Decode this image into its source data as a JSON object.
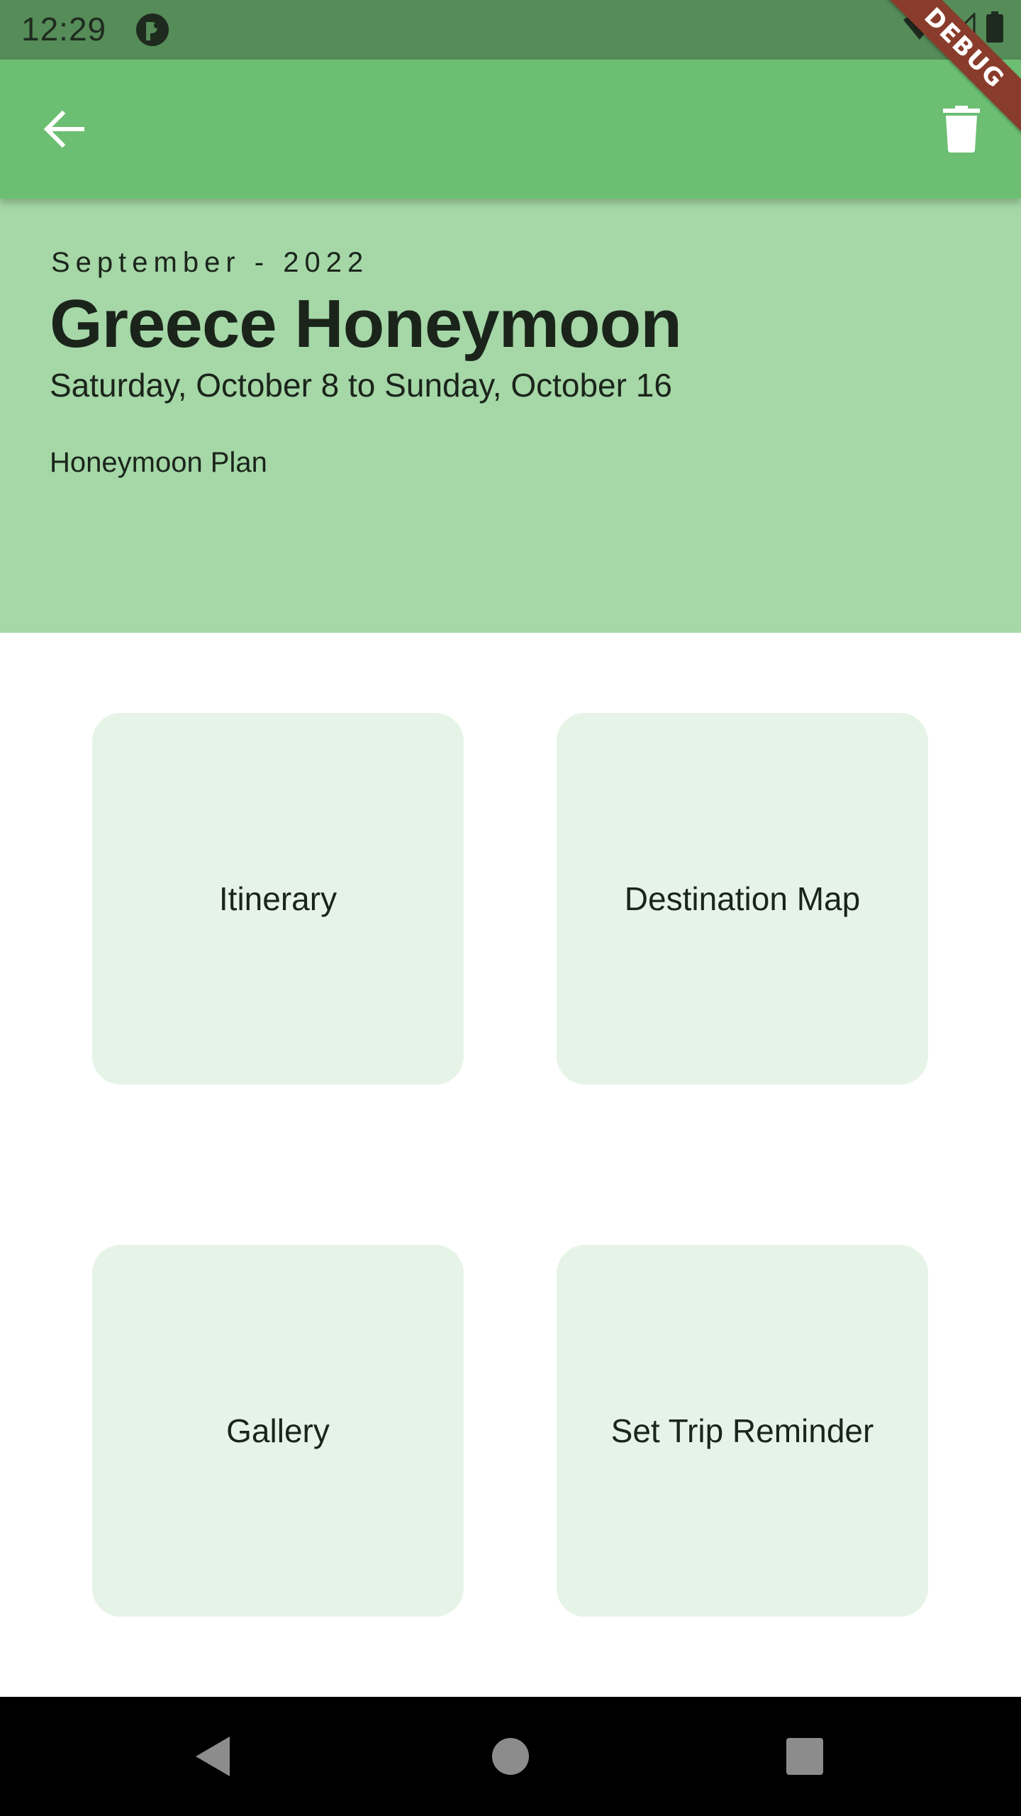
{
  "status_bar": {
    "time": "12:29",
    "icons": [
      "app-notification-icon",
      "wifi-icon",
      "signal-icon",
      "battery-icon"
    ]
  },
  "debug_banner": "DEBUG",
  "app_bar": {
    "back_icon": "arrow-back-icon",
    "delete_icon": "trash-icon"
  },
  "trip": {
    "month_year": "September - 2022",
    "title": "Greece Honeymoon",
    "dates": "Saturday, October 8 to Sunday, October 16",
    "description": "Honeymoon Plan"
  },
  "tiles": [
    {
      "label": "Itinerary"
    },
    {
      "label": "Destination Map"
    },
    {
      "label": "Gallery"
    },
    {
      "label": "Set Trip Reminder"
    }
  ],
  "nav_bar": {
    "icons": [
      "nav-back-icon",
      "nav-home-icon",
      "nav-recents-icon"
    ]
  },
  "colors": {
    "status_bar": "#558c58",
    "app_bar": "#6cbf72",
    "header": "#a5d7a7",
    "tile": "#e6f4e7",
    "debug_ribbon": "#8a3c2c"
  }
}
